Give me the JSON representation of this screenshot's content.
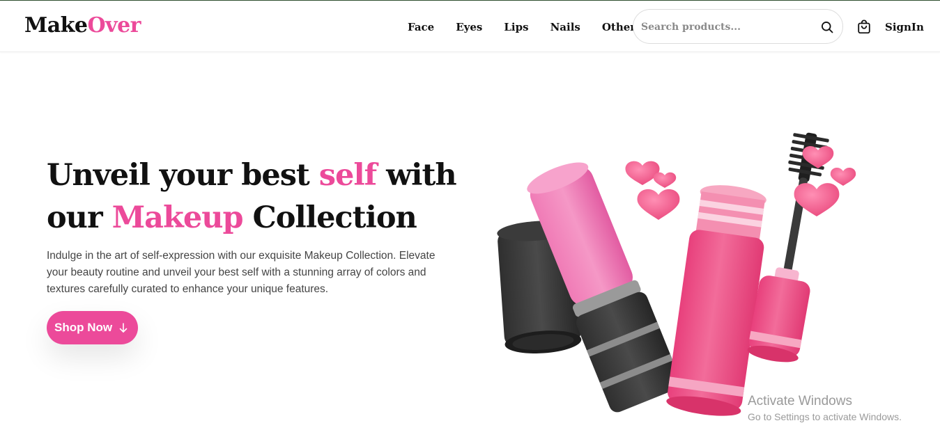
{
  "brand": {
    "logo_part1": "Make",
    "logo_part2": "Over",
    "accent_color": "#ec4a9a"
  },
  "nav": {
    "items": [
      {
        "label": "Face"
      },
      {
        "label": "Eyes"
      },
      {
        "label": "Lips"
      },
      {
        "label": "Nails"
      },
      {
        "label": "Others"
      }
    ]
  },
  "search": {
    "placeholder": "Search products...",
    "value": "",
    "icon": "search-icon"
  },
  "header_actions": {
    "cart_icon": "shopping-bag-icon",
    "signin_label": "SignIn"
  },
  "hero": {
    "title_part1": "Unveil your best ",
    "title_highlight1": "self",
    "title_part2": " with",
    "title_part3": "our ",
    "title_highlight2": "Makeup",
    "title_part4": " Collection",
    "description": "Indulge in the art of self-expression with our exquisite Makeup Collection. Elevate your beauty routine and unveil your best self with a stunning array of colors and textures carefully curated to enhance your unique features.",
    "cta_label": "Shop Now",
    "cta_icon": "arrow-down-icon",
    "image": "makeup-illustration (lipstick, nail polish, mascara, hearts)"
  },
  "watermark": {
    "title": "Activate Windows",
    "subtitle": "Go to Settings to activate Windows."
  }
}
